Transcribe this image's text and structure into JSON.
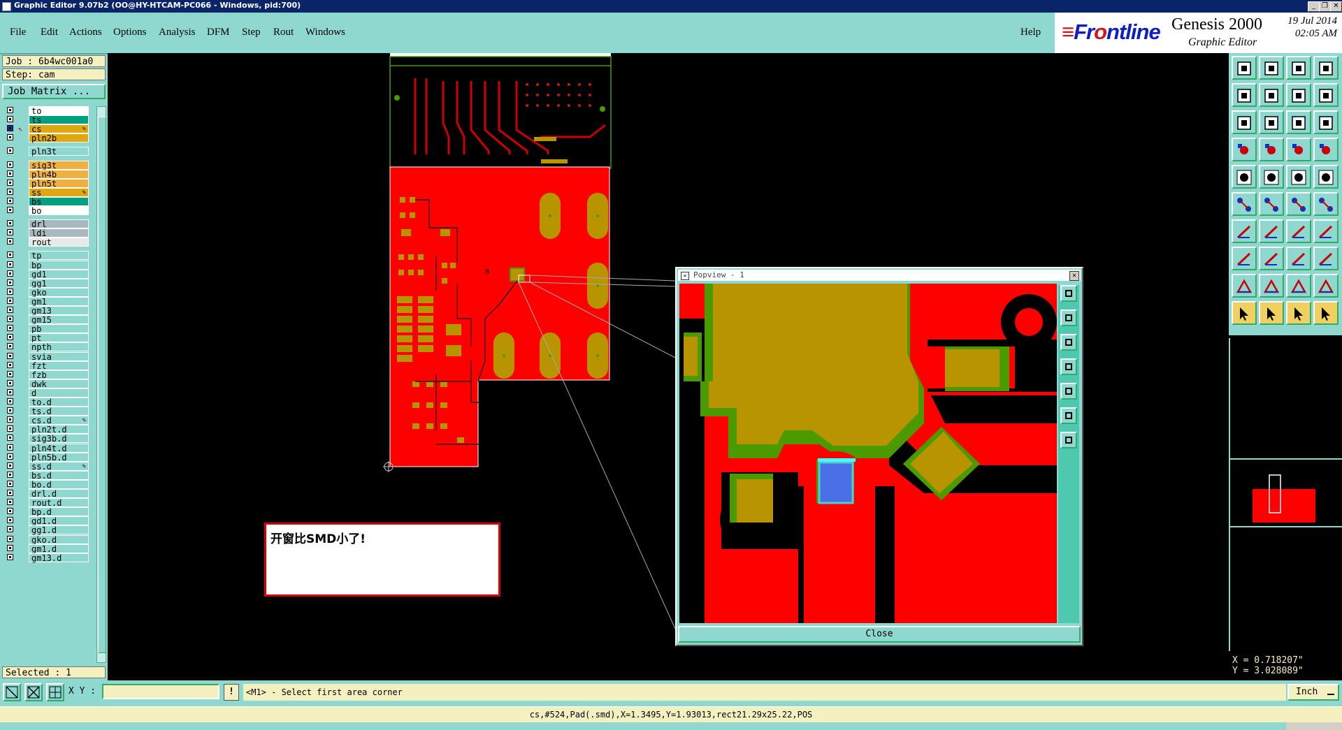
{
  "window": {
    "title": "Graphic Editor 9.07b2 (OO@HY-HTCAM-PC066 - Windows, pid:700)",
    "controls": [
      "_",
      "❐",
      "✕"
    ]
  },
  "menu": {
    "items": [
      "File",
      "Edit",
      "Actions",
      "Options",
      "Analysis",
      "DFM",
      "Step",
      "Rout",
      "Windows"
    ],
    "help": "Help"
  },
  "logo": {
    "brand_pre": "Fr",
    "brand_e": "o",
    "brand_post": "ntline",
    "product": "Genesis 2000",
    "subtitle": "Graphic Editor",
    "date": "19 Jul 2014",
    "time": "02:05 AM"
  },
  "left": {
    "job": "Job : 6b4wc001a0",
    "step": "Step: cam",
    "job_matrix": "Job Matrix ...",
    "selected": "Selected : 1",
    "layers": [
      {
        "name": "to",
        "color": "#ffffff",
        "checked": false,
        "affected": false
      },
      {
        "name": "ts",
        "color": "#00a080",
        "checked": false,
        "affected": false
      },
      {
        "name": "cs",
        "color": "#e0a810",
        "checked": true,
        "affected": true,
        "work": true
      },
      {
        "name": "pln2b",
        "color": "#e0a810",
        "checked": false,
        "affected": false
      },
      {
        "name": "pln3t",
        "color": "#8ed8d0",
        "checked": false,
        "affected": false
      },
      {
        "name": "sig3t",
        "color": "#f0b040",
        "checked": false,
        "affected": false
      },
      {
        "name": "pln4b",
        "color": "#f0b040",
        "checked": false,
        "affected": false
      },
      {
        "name": "pln5t",
        "color": "#f0b040",
        "checked": false,
        "affected": false
      },
      {
        "name": "ss",
        "color": "#e0a810",
        "checked": false,
        "affected": true
      },
      {
        "name": "bs",
        "color": "#00a080",
        "checked": false,
        "affected": false
      },
      {
        "name": "bo",
        "color": "#ffffff",
        "checked": false,
        "affected": false
      },
      {
        "name": "drl",
        "color": "#a8b8c0",
        "checked": false,
        "affected": false
      },
      {
        "name": "ldi",
        "color": "#a8b8c0",
        "checked": false,
        "affected": false
      },
      {
        "name": "rout",
        "color": "#e8e8e8",
        "checked": false,
        "affected": false
      },
      {
        "name": "tp",
        "color": "#8ed8d0",
        "checked": false,
        "affected": false
      },
      {
        "name": "bp",
        "color": "#8ed8d0",
        "checked": false,
        "affected": false
      },
      {
        "name": "gd1",
        "color": "#8ed8d0",
        "checked": false,
        "affected": false
      },
      {
        "name": "gg1",
        "color": "#8ed8d0",
        "checked": false,
        "affected": false
      },
      {
        "name": "gko",
        "color": "#8ed8d0",
        "checked": false,
        "affected": false
      },
      {
        "name": "gm1",
        "color": "#8ed8d0",
        "checked": false,
        "affected": false
      },
      {
        "name": "gm13",
        "color": "#8ed8d0",
        "checked": false,
        "affected": false
      },
      {
        "name": "gm15",
        "color": "#8ed8d0",
        "checked": false,
        "affected": false
      },
      {
        "name": "pb",
        "color": "#8ed8d0",
        "checked": false,
        "affected": false
      },
      {
        "name": "pt",
        "color": "#8ed8d0",
        "checked": false,
        "affected": false
      },
      {
        "name": "npth",
        "color": "#8ed8d0",
        "checked": false,
        "affected": false
      },
      {
        "name": "svia",
        "color": "#8ed8d0",
        "checked": false,
        "affected": false
      },
      {
        "name": "fzt",
        "color": "#8ed8d0",
        "checked": false,
        "affected": false
      },
      {
        "name": "fzb",
        "color": "#8ed8d0",
        "checked": false,
        "affected": false
      },
      {
        "name": "dwk",
        "color": "#8ed8d0",
        "checked": false,
        "affected": false
      },
      {
        "name": "d",
        "color": "#8ed8d0",
        "checked": false,
        "affected": false
      },
      {
        "name": "to.d",
        "color": "#8ed8d0",
        "checked": false,
        "affected": false
      },
      {
        "name": "ts.d",
        "color": "#8ed8d0",
        "checked": false,
        "affected": false
      },
      {
        "name": "cs.d",
        "color": "#8ed8d0",
        "checked": false,
        "affected": true
      },
      {
        "name": "pln2t.d",
        "color": "#8ed8d0",
        "checked": false,
        "affected": false
      },
      {
        "name": "sig3b.d",
        "color": "#8ed8d0",
        "checked": false,
        "affected": false
      },
      {
        "name": "pln4t.d",
        "color": "#8ed8d0",
        "checked": false,
        "affected": false
      },
      {
        "name": "pln5b.d",
        "color": "#8ed8d0",
        "checked": false,
        "affected": false
      },
      {
        "name": "ss.d",
        "color": "#8ed8d0",
        "checked": false,
        "affected": true
      },
      {
        "name": "bs.d",
        "color": "#8ed8d0",
        "checked": false,
        "affected": false
      },
      {
        "name": "bo.d",
        "color": "#8ed8d0",
        "checked": false,
        "affected": false
      },
      {
        "name": "drl.d",
        "color": "#8ed8d0",
        "checked": false,
        "affected": false
      },
      {
        "name": "rout.d",
        "color": "#8ed8d0",
        "checked": false,
        "affected": false
      },
      {
        "name": "bp.d",
        "color": "#8ed8d0",
        "checked": false,
        "affected": false
      },
      {
        "name": "gd1.d",
        "color": "#8ed8d0",
        "checked": false,
        "affected": false
      },
      {
        "name": "gg1.d",
        "color": "#8ed8d0",
        "checked": false,
        "affected": false
      },
      {
        "name": "gko.d",
        "color": "#8ed8d0",
        "checked": false,
        "affected": false
      },
      {
        "name": "gm1.d",
        "color": "#8ed8d0",
        "checked": false,
        "affected": false
      },
      {
        "name": "gm13.d",
        "color": "#8ed8d0",
        "checked": false,
        "affected": false
      }
    ]
  },
  "note": {
    "text": "开窗比SMD小了!"
  },
  "popview": {
    "title": "Popview - 1",
    "close_label": "Close"
  },
  "coords": {
    "x": "X = 0.718207\"",
    "y": "Y = 3.028089\""
  },
  "bottom": {
    "xy_label": "X Y :",
    "xy_value": "",
    "prompt": "<M1> - Select first area corner",
    "units": "Inch",
    "status": "cs,#524,Pad(.smd),X=1.3495,Y=1.93013,rect21.29x25.22,POS"
  },
  "colors": {
    "copper": "#ff0000",
    "mask": "#4a9a00",
    "pad": "#b89400",
    "highlight": "#4a70e8",
    "panel": "#8ed8d0"
  }
}
